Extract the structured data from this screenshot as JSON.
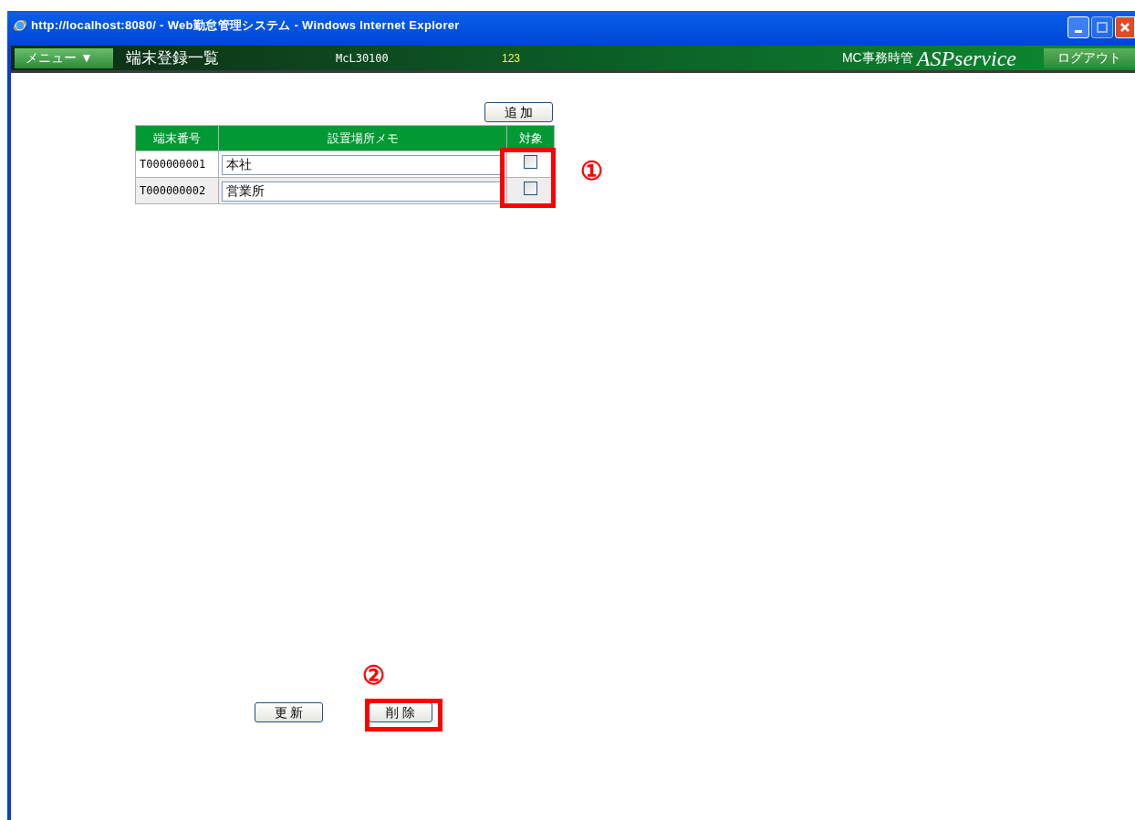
{
  "window": {
    "title": "http://localhost:8080/ - Web勤怠管理システム - Windows Internet Explorer"
  },
  "header": {
    "menu": "メニュー ▼",
    "page_title": "端末登録一覧",
    "screen_id": "McL30100",
    "user_code": "123",
    "product": "MC事務時管",
    "logo": "ASPservice",
    "logout": "ログアウト"
  },
  "add_button": "追 加",
  "table": {
    "columns": [
      "端末番号",
      "設置場所メモ",
      "対象"
    ],
    "rows": [
      {
        "terminal": "T000000001",
        "memo": "本社",
        "checked": false
      },
      {
        "terminal": "T000000002",
        "memo": "営業所",
        "checked": false
      }
    ]
  },
  "annotations": [
    "①",
    "②"
  ],
  "buttons": [
    "更 新",
    "削 除"
  ]
}
